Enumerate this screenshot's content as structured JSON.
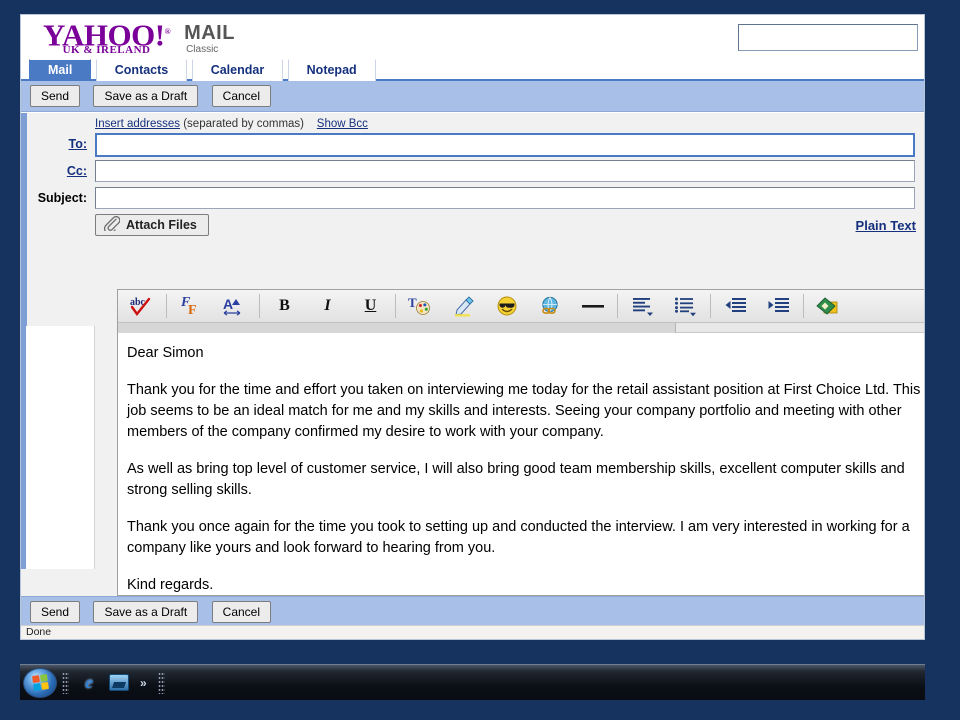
{
  "brand": {
    "logo_text": "YAHOO!",
    "logo_reg": "®",
    "region": "UK & IRELAND",
    "product": "MAIL",
    "product_edition": "Classic",
    "logo_color": "#7b0099"
  },
  "search": {
    "value": "",
    "placeholder": ""
  },
  "tabs": [
    {
      "label": "Mail",
      "active": true
    },
    {
      "label": "Contacts",
      "active": false
    },
    {
      "label": "Calendar",
      "active": false
    },
    {
      "label": "Notepad",
      "active": false
    }
  ],
  "toolbar_top": {
    "send_label": "Send",
    "draft_label": "Save as a Draft",
    "cancel_label": "Cancel"
  },
  "toolbar_bottom": {
    "send_label": "Send",
    "draft_label": "Save as a Draft",
    "cancel_label": "Cancel"
  },
  "compose": {
    "insert_addresses_link": "Insert addresses",
    "insert_addresses_note": "(separated by commas)",
    "show_bcc_link": "Show Bcc",
    "to_label": "To:",
    "to_value": "",
    "cc_label": "Cc:",
    "cc_value": "",
    "subject_label": "Subject:",
    "subject_value": "",
    "attach_label": "Attach Files",
    "plain_text_link": "Plain Text"
  },
  "rte_toolbar": {
    "buttons": [
      {
        "name": "spellcheck-icon",
        "glyph": "abc",
        "title": "Check Spelling"
      },
      {
        "name": "font-family-icon",
        "glyph": "ℱF",
        "title": "Font"
      },
      {
        "name": "font-size-icon",
        "glyph": "A",
        "title": "Font Size"
      },
      {
        "name": "bold-icon",
        "glyph": "B",
        "title": "Bold"
      },
      {
        "name": "italic-icon",
        "glyph": "I",
        "title": "Italic"
      },
      {
        "name": "underline-icon",
        "glyph": "U",
        "title": "Underline"
      },
      {
        "name": "text-color-icon",
        "glyph": "T",
        "title": "Text Colour"
      },
      {
        "name": "highlighter-icon",
        "glyph": "✐",
        "title": "Highlight"
      },
      {
        "name": "emoticon-icon",
        "glyph": "☺",
        "title": "Insert Emoticon"
      },
      {
        "name": "insert-link-icon",
        "glyph": "⚭",
        "title": "Insert Link"
      },
      {
        "name": "horizontal-rule-icon",
        "glyph": "—",
        "title": "Horizontal Line"
      },
      {
        "name": "align-icon",
        "glyph": "≡",
        "title": "Align"
      },
      {
        "name": "list-icon",
        "glyph": "☰",
        "title": "Lists"
      },
      {
        "name": "decrease-indent-icon",
        "glyph": "⇤",
        "title": "Decrease Indent"
      },
      {
        "name": "increase-indent-icon",
        "glyph": "⇥",
        "title": "Increase Indent"
      },
      {
        "name": "stationery-icon",
        "glyph": "◆",
        "title": "Stationery"
      }
    ]
  },
  "message": {
    "greeting": "Dear Simon",
    "paragraph_1": "Thank you for the time and effort you taken on interviewing me today for the retail assistant position at First Choice  Ltd. This job seems to be an ideal match for me and my skills and interests. Seeing your company portfolio and meeting with other members of the company confirmed my desire to work with your company.",
    "paragraph_2": "As well as bring top level of customer service, I will also bring good team membership skills, excellent computer skills and strong selling skills.",
    "paragraph_3": "Thank you once again for the time you took to setting up and conducted the interview. I am very interested in working for a company like yours and look forward to hearing from you.",
    "closing": "Kind regards."
  },
  "status": {
    "text": "Done"
  },
  "taskbar": {
    "start_label": "Start",
    "apps": [
      {
        "name": "internet-explorer-icon",
        "label": "Internet Explorer"
      },
      {
        "name": "media-player-icon",
        "label": "Windows Media Player"
      }
    ],
    "overflow_chevron": "»"
  }
}
